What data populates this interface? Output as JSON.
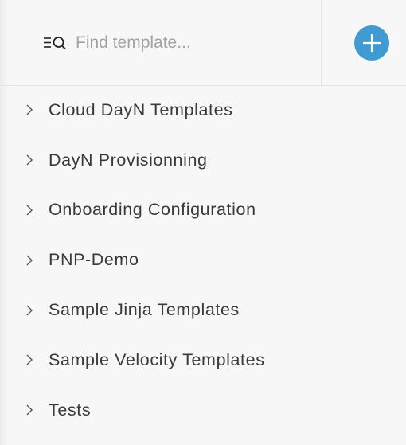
{
  "search": {
    "placeholder": "Find template...",
    "value": ""
  },
  "add_button": {
    "icon": "plus-icon",
    "color": "#3f9bd2"
  },
  "templates": [
    {
      "label": "Cloud DayN Templates",
      "icon": "chevron-right-icon"
    },
    {
      "label": "DayN Provisionning",
      "icon": "chevron-right-icon"
    },
    {
      "label": "Onboarding Configuration",
      "icon": "chevron-right-icon"
    },
    {
      "label": "PNP-Demo",
      "icon": "chevron-right-icon"
    },
    {
      "label": "Sample Jinja Templates",
      "icon": "chevron-right-icon"
    },
    {
      "label": "Sample Velocity Templates",
      "icon": "chevron-right-icon"
    },
    {
      "label": "Tests",
      "icon": "chevron-right-icon"
    }
  ]
}
